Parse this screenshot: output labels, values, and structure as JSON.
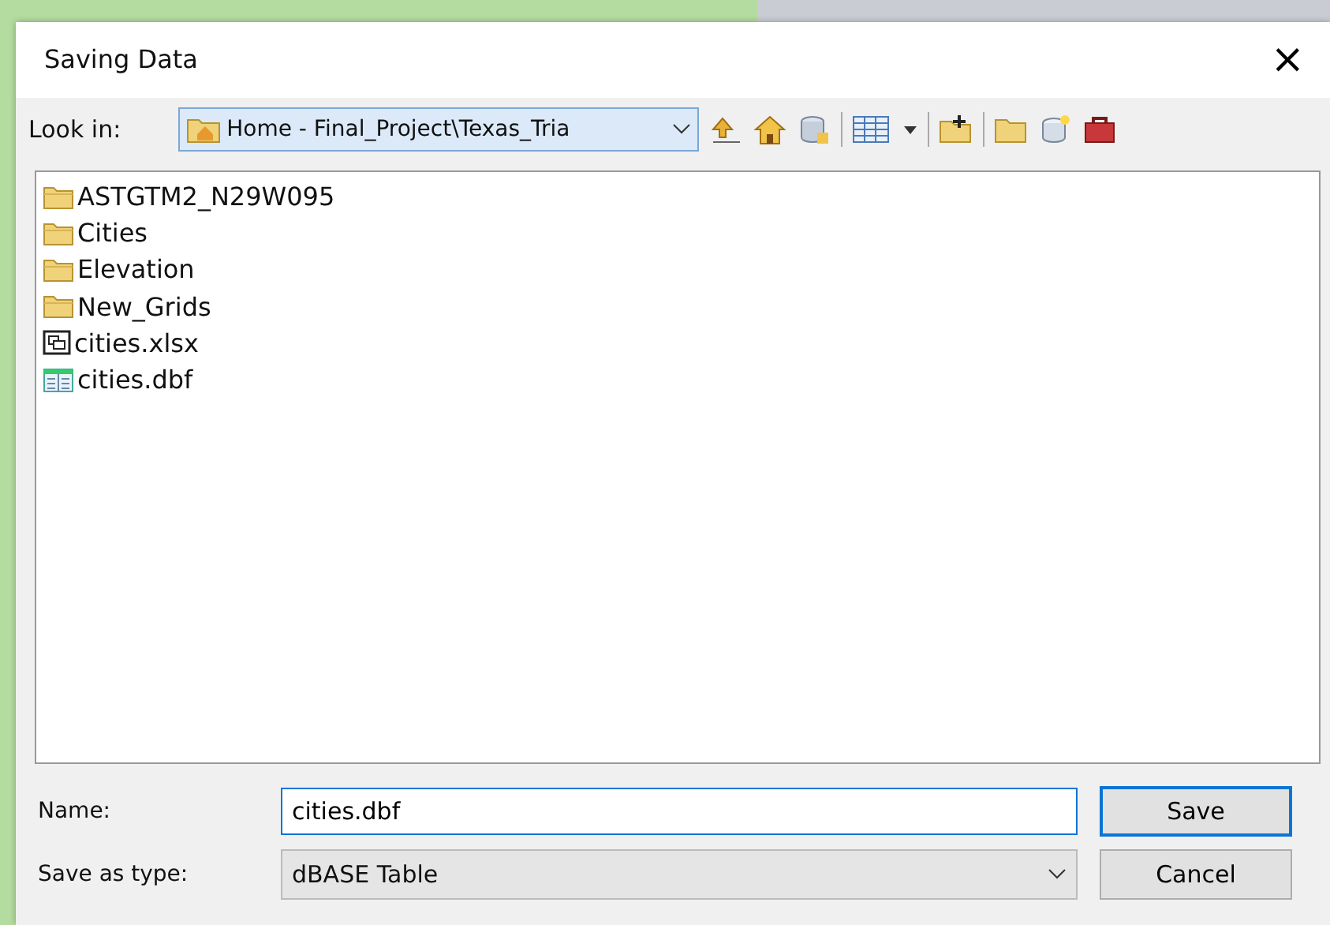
{
  "window": {
    "title": "Saving Data",
    "close": "×"
  },
  "look_in": {
    "label": "Look in:",
    "value": "Home - Final_Project\\Texas_Tria"
  },
  "files": [
    {
      "name": "ASTGTM2_N29W095",
      "kind": "folder"
    },
    {
      "name": "Cities",
      "kind": "folder"
    },
    {
      "name": "Elevation",
      "kind": "folder"
    },
    {
      "name": "New_Grids",
      "kind": "folder"
    },
    {
      "name": "cities.xlsx",
      "kind": "sheet"
    },
    {
      "name": "cities.dbf",
      "kind": "table"
    }
  ],
  "name_field": {
    "label": "Name:",
    "value": "cities.dbf"
  },
  "type_field": {
    "label": "Save as type:",
    "value": "dBASE Table"
  },
  "buttons": [
    "Save",
    "Cancel"
  ]
}
